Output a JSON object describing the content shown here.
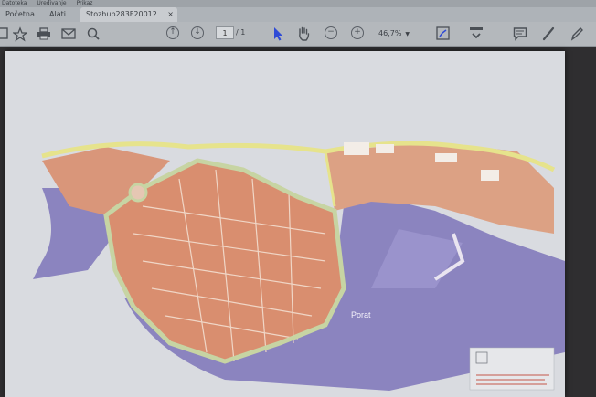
{
  "menubar": {
    "items": [
      "Datoteka",
      "Uređivanje",
      "Prikaz"
    ]
  },
  "tabs": {
    "home": "Početna",
    "tools": "Alati",
    "document": "Stozhub283F20012...",
    "close": "×"
  },
  "toolbar": {
    "page_current": "1",
    "page_total": "/ 1",
    "zoom": "46,7%",
    "icons": [
      "save-icon",
      "bookmark-icon",
      "print-icon",
      "email-icon",
      "search-icon",
      "page-up-icon",
      "page-down-icon",
      "select-cursor-icon",
      "hand-icon",
      "zoom-out-icon",
      "zoom-in-icon",
      "fit-page-icon",
      "scroll-icon",
      "comment-icon",
      "sign-icon",
      "pen-icon"
    ]
  },
  "map": {
    "port_label": "Porat",
    "colors": {
      "sea": "#8b84bf",
      "land": "#d98e6f",
      "walls": "#c7d4a3",
      "road": "#e6e38c",
      "paper": "#d9dbe0"
    }
  }
}
